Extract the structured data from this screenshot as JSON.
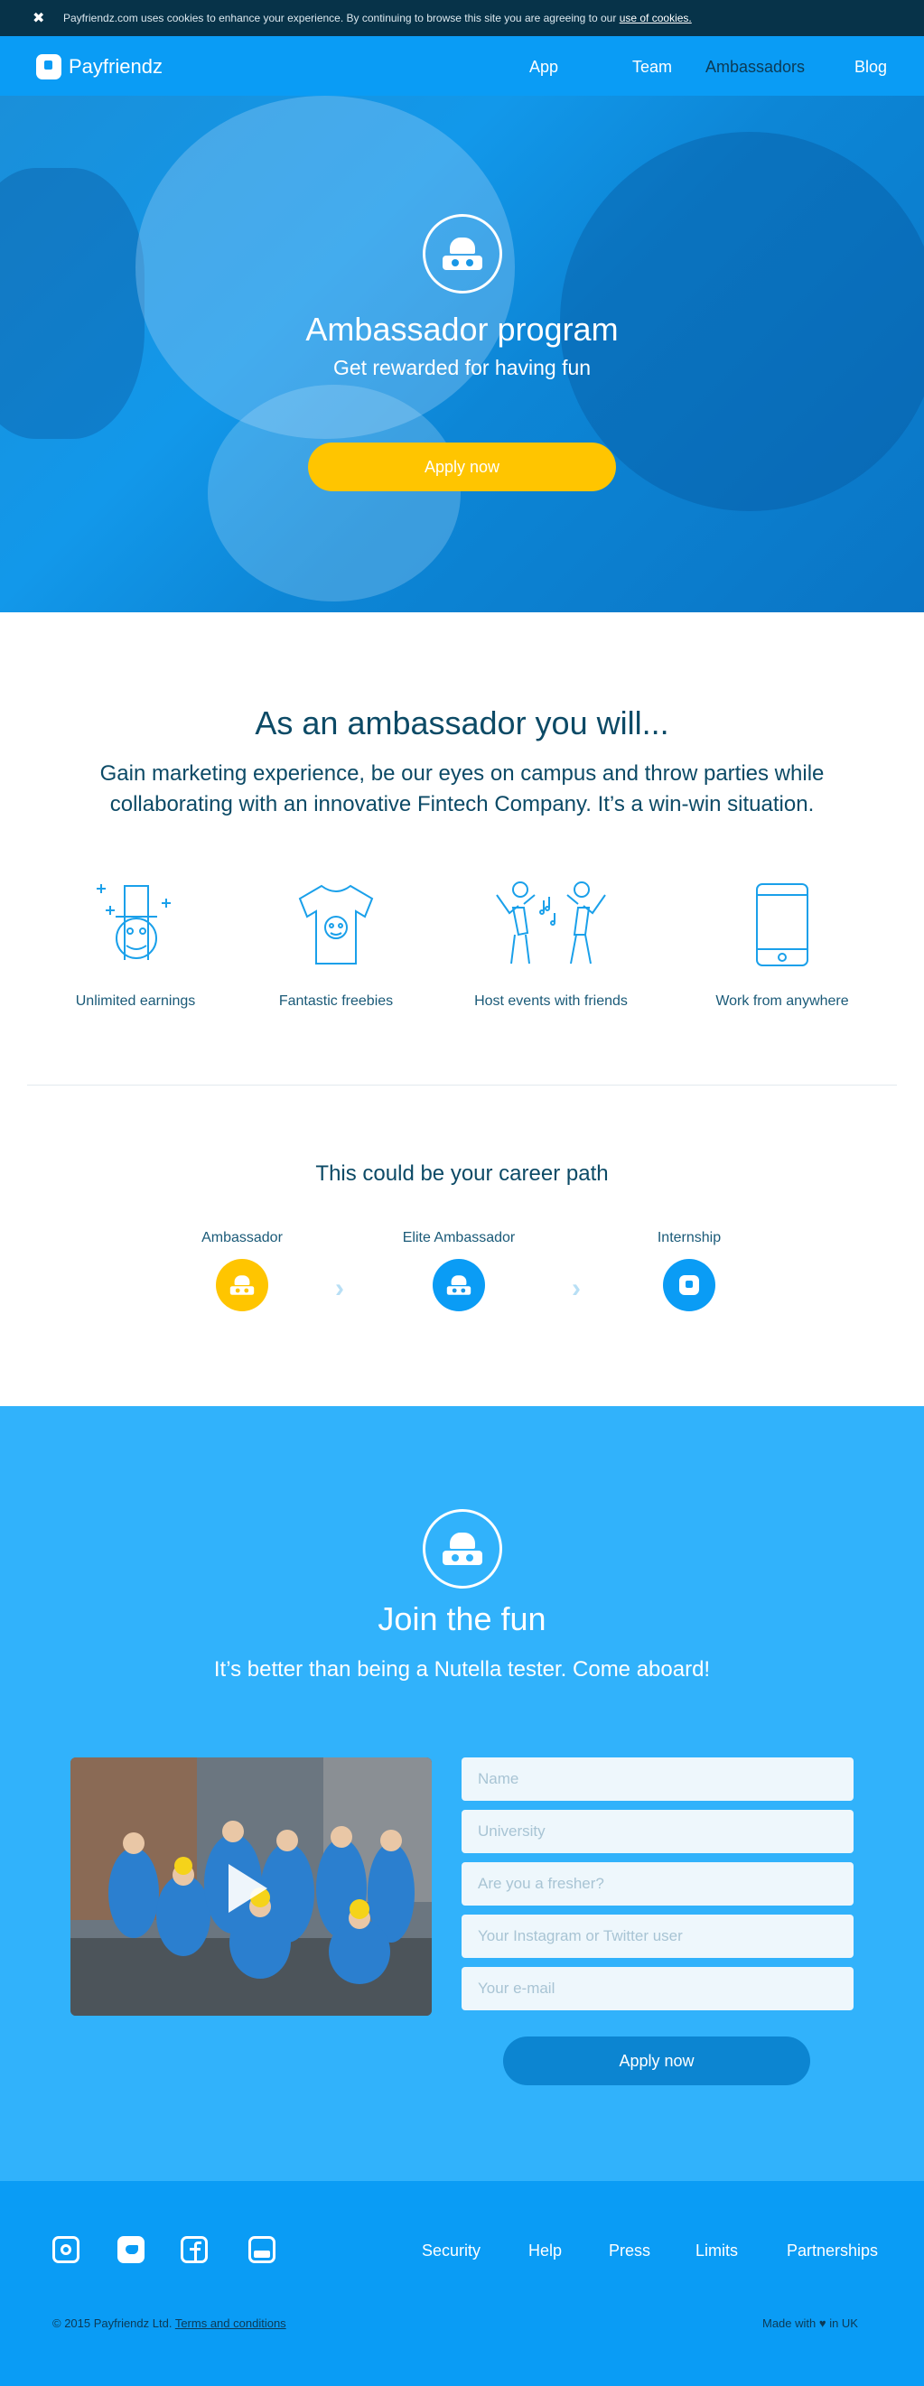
{
  "cookie": {
    "text": "Payfriendz.com uses cookies to enhance your experience. By continuing to browse this site you are agreeing to our",
    "link": "use of cookies.",
    "close_glyph": "✖"
  },
  "nav": {
    "brand": "Payfriendz",
    "links": [
      "App",
      "Team",
      "Ambassadors",
      "Blog"
    ]
  },
  "hero": {
    "title": "Ambassador program",
    "subtitle": "Get rewarded for having fun",
    "cta": "Apply now"
  },
  "ambassador": {
    "title": "As an ambassador you will...",
    "intro": "Gain marketing experience, be our eyes on campus and throw parties while collaborating with an innovative Fintech Company. It’s a win-win situation.",
    "features": [
      {
        "label": "Unlimited earnings",
        "icon": "hat-money-icon"
      },
      {
        "label": "Fantastic freebies",
        "icon": "tshirt-icon"
      },
      {
        "label": "Host events with friends",
        "icon": "dancing-friends-icon"
      },
      {
        "label": "Work from anywhere",
        "icon": "phone-icon"
      }
    ]
  },
  "career": {
    "title": "This could be your career path",
    "steps": [
      {
        "label": "Ambassador",
        "color": "#ffc500"
      },
      {
        "label": "Elite Ambassador",
        "color": "#0a9cf5"
      },
      {
        "label": "Internship",
        "color": "#0a9cf5"
      }
    ],
    "arrow": "›"
  },
  "join": {
    "title": "Join the fun",
    "subtitle": "It’s better than being a Nutella tester. Come aboard!",
    "form": {
      "name_placeholder": "Name",
      "university_placeholder": "University",
      "fresher_placeholder": "Are you a fresher?",
      "social_placeholder": "Your Instagram or Twitter user",
      "email_placeholder": "Your e-mail",
      "submit": "Apply now"
    }
  },
  "footer": {
    "social": [
      "instagram-icon",
      "twitter-icon",
      "facebook-icon",
      "youtube-icon"
    ],
    "links": [
      "Security",
      "Help",
      "Press",
      "Limits",
      "Partnerships"
    ],
    "copyright": "© 2015 Payfriendz Ltd.",
    "terms": "Terms and conditions",
    "made_with": "Made with ♥ in UK"
  },
  "colors": {
    "brand_blue": "#0a9cf5",
    "accent_yellow": "#ffc500",
    "join_bg": "#31b2fb",
    "dark_navy": "#073349"
  }
}
